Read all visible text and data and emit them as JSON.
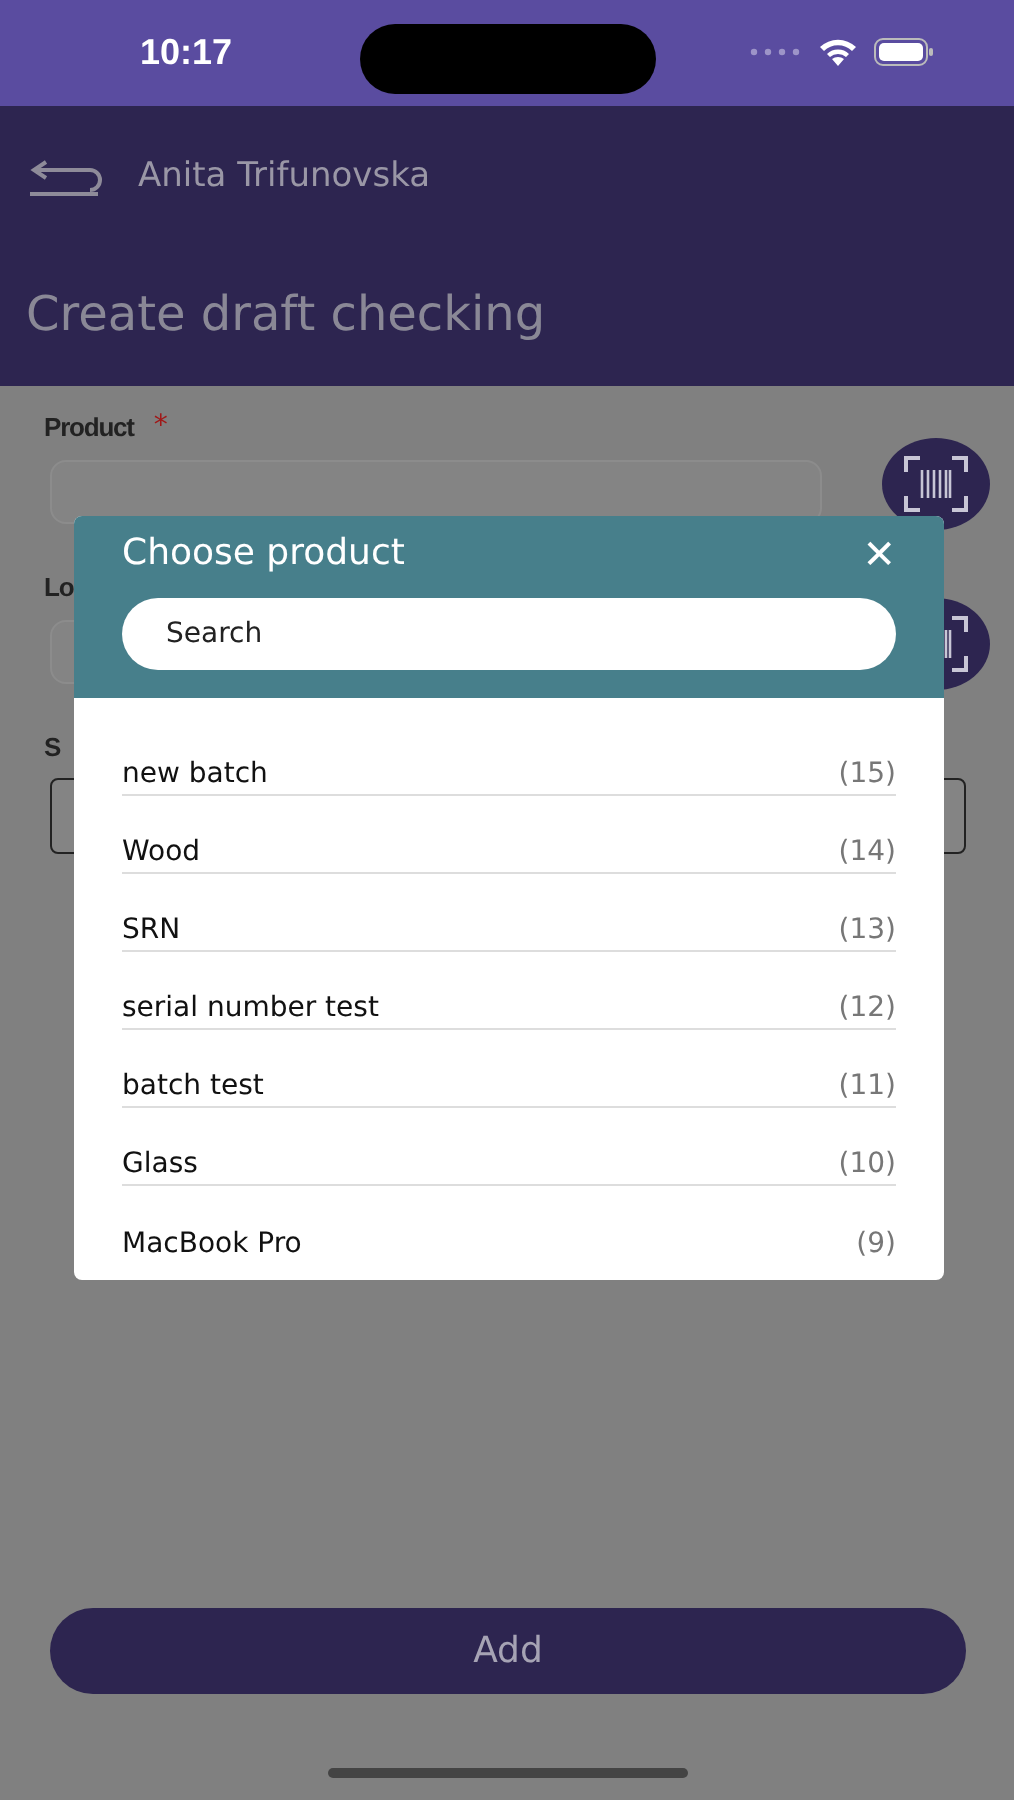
{
  "status_bar": {
    "time": "10:17"
  },
  "header": {
    "user": "Anita Trifunovska",
    "title": "Create draft checking"
  },
  "form": {
    "fields": [
      {
        "label": "Product",
        "required_mark": "*",
        "kind": "scan"
      },
      {
        "label": "Lo",
        "kind": "scan"
      },
      {
        "label": "S",
        "kind": "plain"
      }
    ]
  },
  "add_button": "Add",
  "dialog": {
    "title": "Choose product",
    "close": "✕",
    "search": {
      "placeholder": "Search"
    },
    "items": [
      {
        "name": "new batch",
        "count": "(15)"
      },
      {
        "name": "Wood",
        "count": "(14)"
      },
      {
        "name": "SRN",
        "count": "(13)"
      },
      {
        "name": "serial number test",
        "count": "(12)"
      },
      {
        "name": "batch test",
        "count": "(11)"
      },
      {
        "name": "Glass",
        "count": "(10)"
      },
      {
        "name": "MacBook Pro",
        "count": "(9)"
      }
    ]
  }
}
